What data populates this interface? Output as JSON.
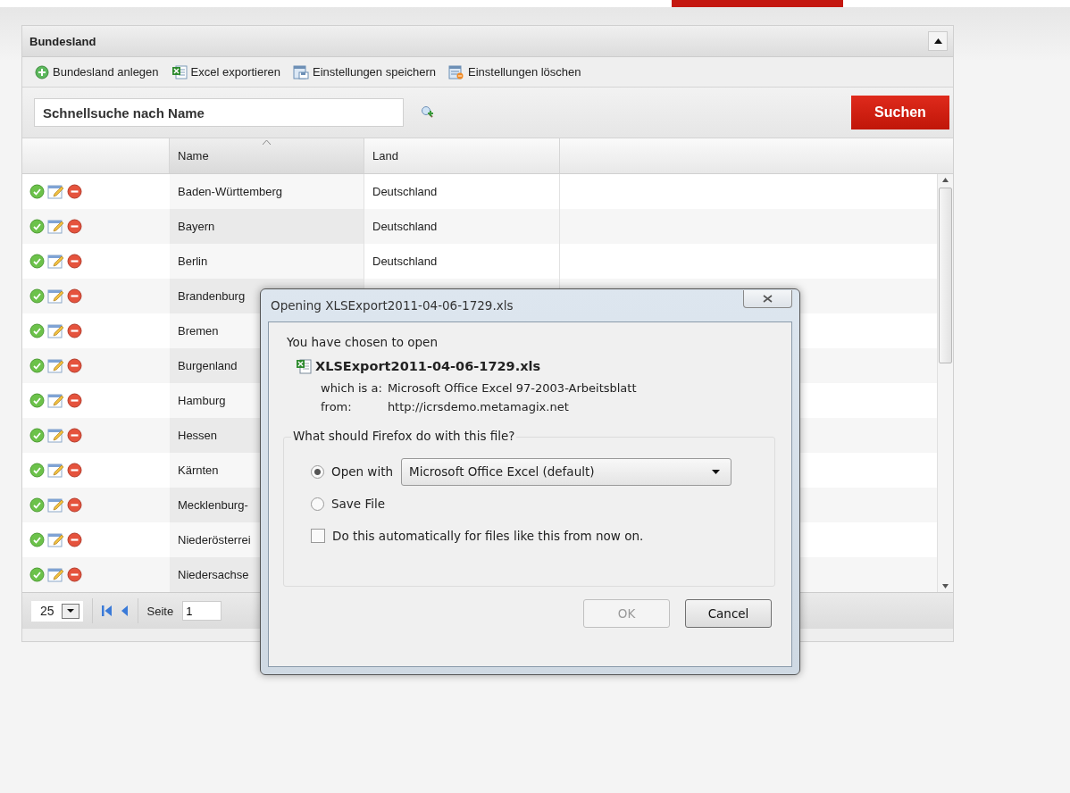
{
  "panel": {
    "title": "Bundesland"
  },
  "toolbar": [
    {
      "kind": "add",
      "label": "Bundesland anlegen"
    },
    {
      "kind": "excel",
      "label": "Excel exportieren"
    },
    {
      "kind": "save",
      "label": "Einstellungen speichern"
    },
    {
      "kind": "clear",
      "label": "Einstellungen löschen"
    }
  ],
  "search": {
    "placeholder": "Schnellsuche nach Name",
    "button": "Suchen"
  },
  "table": {
    "columns": [
      {
        "label": "Name",
        "sorted": true
      },
      {
        "label": "Land",
        "sorted": false
      }
    ],
    "rows": [
      {
        "name": "Baden-Württemberg",
        "land": "Deutschland"
      },
      {
        "name": "Bayern",
        "land": "Deutschland"
      },
      {
        "name": "Berlin",
        "land": "Deutschland"
      },
      {
        "name": "Brandenburg"
      },
      {
        "name": "Bremen"
      },
      {
        "name": "Burgenland"
      },
      {
        "name": "Hamburg"
      },
      {
        "name": "Hessen"
      },
      {
        "name": "Kärnten"
      },
      {
        "name": "Mecklenburg-"
      },
      {
        "name": "Niederösterrei"
      },
      {
        "name": "Niedersachse"
      }
    ]
  },
  "pager": {
    "page_size": "25",
    "page_label": "Seite",
    "page": "1"
  },
  "dialog": {
    "title": "Opening XLSExport2011-04-06-1729.xls",
    "intro": "You have chosen to open",
    "filename": "XLSExport2011-04-06-1729.xls",
    "type_label": "which is a:",
    "type_value": "Microsoft Office Excel 97-2003-Arbeitsblatt",
    "from_label": "from:",
    "from_value": "http://icrsdemo.metamagix.net",
    "legend": "What should Firefox do with this file?",
    "options": [
      {
        "label": "Open with",
        "selected": true
      },
      {
        "label": "Save File",
        "selected": false
      }
    ],
    "app": "Microsoft Office Excel (default)",
    "remember": {
      "label": "Do this automatically for files like this from now on.",
      "checked": false
    },
    "buttons": [
      {
        "label": "OK",
        "disabled": true
      },
      {
        "label": "Cancel",
        "disabled": false
      }
    ]
  }
}
